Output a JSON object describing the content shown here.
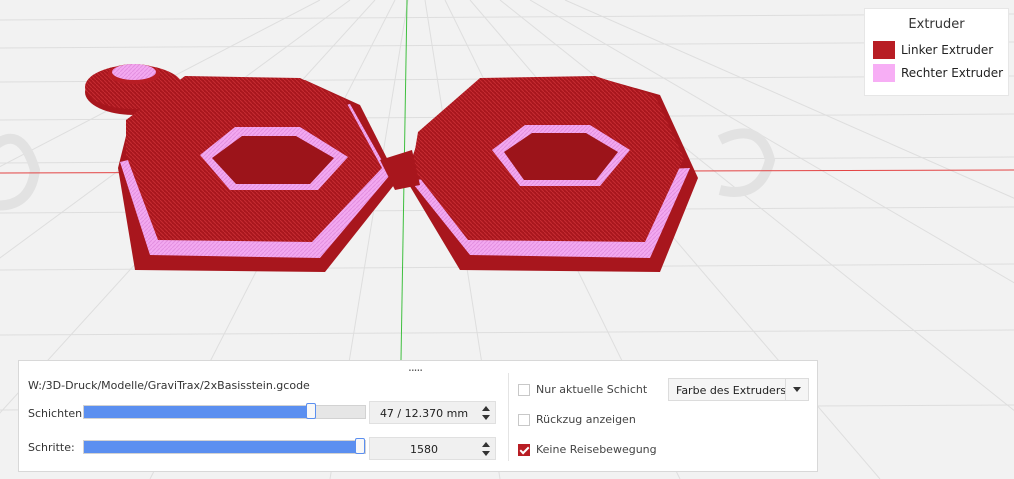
{
  "legend": {
    "title": "Extruder",
    "items": [
      {
        "label": "Linker Extruder",
        "color": "#b81d24"
      },
      {
        "label": "Rechter Extruder",
        "color": "#f7aef5"
      }
    ]
  },
  "panel": {
    "file_path": "W:/3D-Druck/Modelle/GraviTrax/2xBasisstein.gcode",
    "layers": {
      "label": "Schichten:",
      "value_text": "47 / 12.370 mm",
      "fraction": 0.82
    },
    "steps": {
      "label": "Schritte:",
      "value_text": "1580",
      "fraction": 1.0
    },
    "options": [
      {
        "label": "Nur aktuelle Schicht",
        "checked": false
      },
      {
        "label": "Rückzug anzeigen",
        "checked": false
      },
      {
        "label": "Keine Reisebewegung",
        "checked": true
      }
    ],
    "color_mode": {
      "selected": "Farbe des Extruders"
    }
  },
  "colors": {
    "left_extruder": "#b81d24",
    "right_extruder": "#f7aef5",
    "x_axis": "#e34444",
    "y_axis": "#3fbf3f",
    "grid": "#dddddd",
    "accent": "#5b8ff0"
  }
}
